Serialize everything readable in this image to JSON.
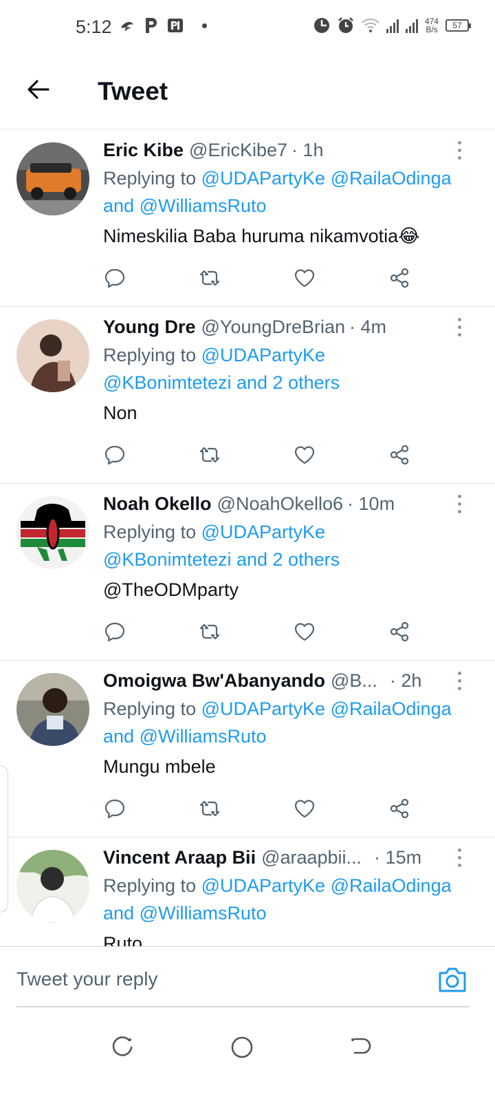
{
  "status_bar": {
    "time": "5:12",
    "net_speed_top": "474",
    "net_speed_unit": "B/s",
    "battery": "57",
    "icons": [
      "wind-icon",
      "p-icon",
      "pl-icon",
      "dot-icon",
      "moon-icon",
      "alarm-icon",
      "wifi-icon",
      "signal-icon",
      "signal-icon",
      "battery-icon"
    ]
  },
  "header": {
    "title": "Tweet",
    "back_icon": "arrow-left-icon"
  },
  "tweets": [
    {
      "name": "Eric Kibe",
      "handle": "@EricKibe7",
      "time": "· 1h",
      "reply_prefix": "Replying to",
      "mentions": [
        "@UDAPartyKe",
        "@RailaOdinga"
      ],
      "reply_and": "and",
      "mention_last": "@WilliamsRuto",
      "text": "Nimeskilia Baba huruma nikamvotia😂",
      "avatar_colors": [
        "#e07b2c",
        "#5a5a5a"
      ]
    },
    {
      "name": "Young Dre",
      "handle": "@YoungDreBrian",
      "time": "· 4m",
      "reply_prefix": "Replying to",
      "mentions": [
        "@UDAPartyKe",
        "@KBonimtetezi and 2 others"
      ],
      "text": "Non",
      "avatar_colors": [
        "#c9a28e",
        "#3b2a22"
      ]
    },
    {
      "name": "Noah Okello",
      "handle": "@NoahOkello6",
      "time": "· 10m",
      "reply_prefix": "Replying to",
      "mentions": [
        "@UDAPartyKe",
        "@KBonimtetezi and 2 others"
      ],
      "text_mention": "@TheODMparty",
      "avatar_colors": [
        "#000000",
        "#c1272d",
        "#1e8b3a"
      ]
    },
    {
      "name": "Omoigwa Bw'Abanyando",
      "handle": "@B...",
      "time": "· 2h",
      "reply_prefix": "Replying to",
      "mentions": [
        "@UDAPartyKe",
        "@RailaOdinga"
      ],
      "reply_and": "and",
      "mention_last": "@WilliamsRuto",
      "text": "Mungu mbele",
      "avatar_colors": [
        "#8a8a7e",
        "#3a4b6a"
      ]
    },
    {
      "name": "Vincent Araap Bii",
      "handle": "@araapbii...",
      "time": "· 15m",
      "reply_prefix": "Replying to",
      "mentions": [
        "@UDAPartyKe",
        "@RailaOdinga"
      ],
      "reply_and": "and",
      "mention_last": "@WilliamsRuto",
      "text": "Ruto",
      "avatar_colors": [
        "#d8e6d0",
        "#2c2c2c"
      ]
    }
  ],
  "actions": [
    "reply-icon",
    "retweet-icon",
    "like-icon",
    "share-icon"
  ],
  "reply_bar": {
    "placeholder": "Tweet your reply",
    "camera_icon": "camera-icon"
  },
  "nav_bar": {
    "buttons": [
      "recents-icon",
      "home-icon",
      "back-nav-icon"
    ]
  },
  "colors": {
    "accent": "#1d9bf0",
    "text": "#0f1419",
    "secondary": "#536471",
    "divider": "#e1e8ed"
  }
}
